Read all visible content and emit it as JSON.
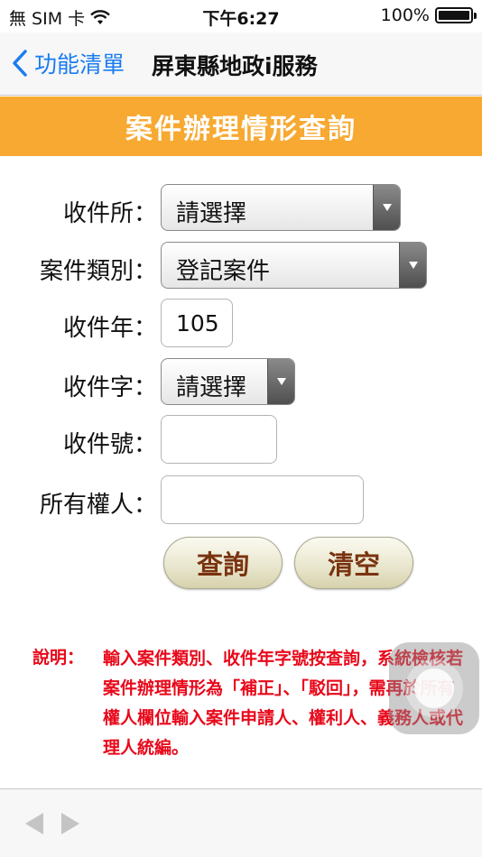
{
  "status_bar": {
    "carrier": "無 SIM 卡",
    "time": "下午6:27",
    "battery_text": "100%",
    "battery_level": 1.0
  },
  "nav": {
    "back_label": "功能清單",
    "title": "屏東縣地政i服務"
  },
  "header": {
    "title": "案件辦理情形查詢",
    "color": "#f7a932"
  },
  "form": {
    "office": {
      "label": "收件所：",
      "value": "請選擇"
    },
    "category": {
      "label": "案件類別：",
      "value": "登記案件"
    },
    "year": {
      "label": "收件年：",
      "value": "105"
    },
    "word": {
      "label": "收件字：",
      "value": "請選擇"
    },
    "number": {
      "label": "收件號：",
      "value": ""
    },
    "owner": {
      "label": "所有權人：",
      "value": ""
    }
  },
  "buttons": {
    "query": "查詢",
    "clear": "清空"
  },
  "note": {
    "label": "說明：",
    "text": "輸入案件類別、收件年字號按查詢，系統檢核若案件辦理情形為「補正」、「駁回」，需再於所有權人欄位輸入案件申請人、權利人、義務人或代理人統編。",
    "color": "#e8081a"
  },
  "colors": {
    "accent": "#1a7cf0",
    "button_text": "#7a3310"
  },
  "icons": {
    "back": "chevron-left-icon",
    "wifi": "wifi-icon",
    "battery": "battery-icon",
    "toolbar_back": "triangle-left-icon",
    "toolbar_forward": "triangle-right-icon",
    "assistive": "assistive-touch-icon"
  }
}
